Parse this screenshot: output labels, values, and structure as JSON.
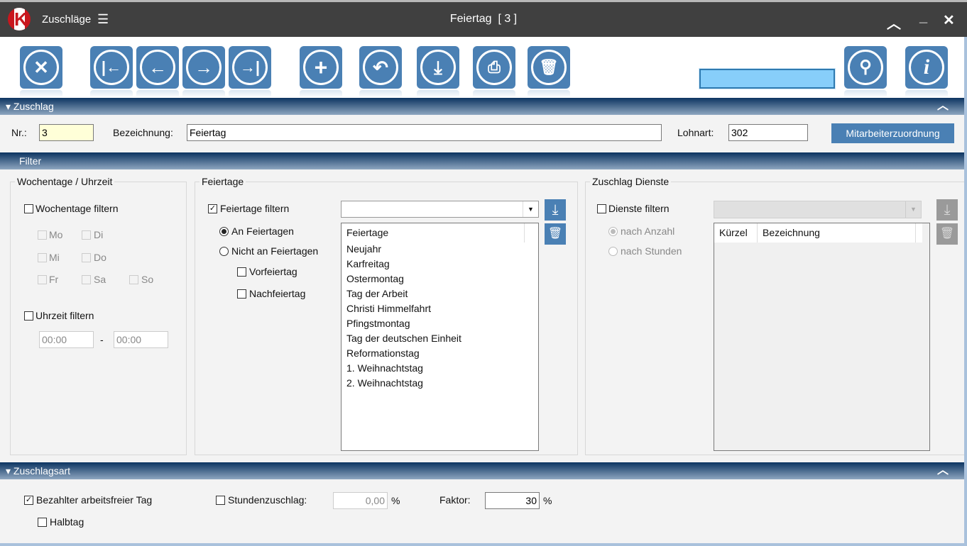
{
  "titlebar": {
    "app_name": "Zuschläge",
    "window_title": "Feiertag  [ 3 ]",
    "logo_letter": "K"
  },
  "toolbar": {
    "search_value": ""
  },
  "sections": {
    "zuschlag": "Zuschlag",
    "filter": "Filter",
    "zuschlagsart": "Zuschlagsart"
  },
  "zuschlag": {
    "nr_label": "Nr.:",
    "nr_value": "3",
    "bezeichnung_label": "Bezeichnung:",
    "bezeichnung_value": "Feiertag",
    "lohnart_label": "Lohnart:",
    "lohnart_value": "302",
    "mitarbeiter_button": "Mitarbeiterzuordnung"
  },
  "wochentage": {
    "title": "Wochentage / Uhrzeit",
    "filter_label": "Wochentage filtern",
    "filter_checked": false,
    "days": [
      "Mo",
      "Di",
      "Mi",
      "Do",
      "Fr",
      "Sa",
      "So"
    ],
    "uhrzeit_label": "Uhrzeit filtern",
    "uhrzeit_checked": false,
    "time_from": "00:00",
    "time_sep": "-",
    "time_to": "00:00"
  },
  "feiertage": {
    "title": "Feiertage",
    "filter_label": "Feiertage filtern",
    "filter_checked": true,
    "dropdown_value": "",
    "radio_an": "An Feiertagen",
    "radio_nicht": "Nicht an Feiertagen",
    "selected_radio": "An Feiertagen",
    "vorfeiertag": "Vorfeiertag",
    "nachfeiertag": "Nachfeiertag",
    "list_header": "Feiertage",
    "list": [
      "Neujahr",
      "Karfreitag",
      "Ostermontag",
      "Tag der Arbeit",
      "Christi Himmelfahrt",
      "Pfingstmontag",
      "Tag der deutschen Einheit",
      "Reformationstag",
      "1. Weihnachtstag",
      "2. Weihnachtstag"
    ]
  },
  "dienste": {
    "title": "Zuschlag Dienste",
    "filter_label": "Dienste filtern",
    "filter_checked": false,
    "radio_anzahl": "nach Anzahl",
    "radio_stunden": "nach Stunden",
    "col_kuerzel": "Kürzel",
    "col_bezeichnung": "Bezeichnung"
  },
  "zuschlagsart": {
    "bezahlt_label": "Bezahlter arbeitsfreier Tag",
    "bezahlt_checked": true,
    "halbtag_label": "Halbtag",
    "stunden_label": "Stundenzuschlag:",
    "stunden_value": "0,00",
    "percent": "%",
    "faktor_label": "Faktor:",
    "faktor_value": "30"
  },
  "colors": {
    "accent": "#4a80b4",
    "titlebar": "#404040",
    "search_bg": "#87cefa",
    "nr_bg": "#ffffd8"
  }
}
